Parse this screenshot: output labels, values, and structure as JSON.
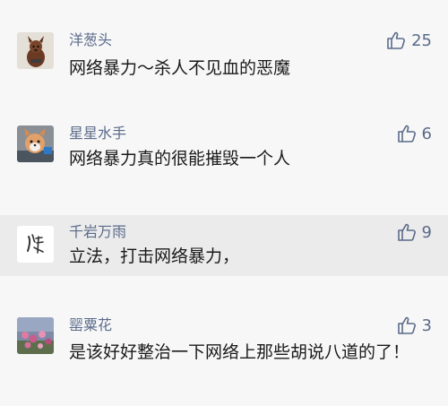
{
  "comments": [
    {
      "avatar_icon": "dog-avatar-icon",
      "name": "洋葱头",
      "likes": "25",
      "text": "网络暴力～杀人不见血的恶魔"
    },
    {
      "avatar_icon": "fox-avatar-icon",
      "name": "星星水手",
      "likes": "6",
      "text": "网络暴力真的很能摧毁一个人"
    },
    {
      "avatar_icon": "calligraphy-avatar-icon",
      "name": "千岩万雨",
      "likes": "9",
      "text": "立法，打击网络暴力，"
    },
    {
      "avatar_icon": "flowers-avatar-icon",
      "name": "罂粟花",
      "likes": "3",
      "text": "是该好好整治一下网络上那些胡说八道的了！"
    }
  ],
  "like_icon": "thumbs-up-icon",
  "colors": {
    "background": "#f7f7f7",
    "highlight_row": "#ebebeb",
    "name_text": "#5b6b8a",
    "body_text": "#1a1a1a"
  }
}
